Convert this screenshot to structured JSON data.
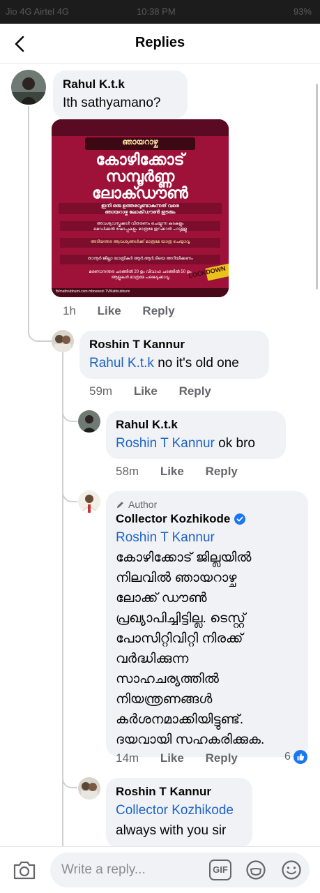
{
  "status": {
    "left": "Jio 4G Airtel 4G",
    "time": "10:38 PM",
    "right": "93%"
  },
  "header": {
    "title": "Replies"
  },
  "comments": [
    {
      "name": "Rahul K.t.k",
      "text": "Ith sathyamano?",
      "time": "1h",
      "like": "Like",
      "reply": "Reply"
    },
    {
      "name": "Roshin T Kannur",
      "mention": "Rahul K.t.k",
      "text": " no it's old one",
      "time": "59m",
      "like": "Like",
      "reply": "Reply"
    },
    {
      "name": "Rahul K.t.k",
      "mention": "Roshin T Kannur",
      "text": " ok bro",
      "time": "58m",
      "like": "Like",
      "reply": "Reply"
    },
    {
      "author_tag": "Author",
      "name": "Collector Kozhikode",
      "mention": "Roshin T Kannur",
      "lines": [
        "കോഴിക്കോട് ജില്ലയിൽ",
        "നിലവിൽ ഞായറാഴ്ച",
        "ലോക്ക് ഡൗൺ",
        "പ്രഖ്യാപിച്ചിട്ടില്ല. ടെസ്റ്റ്",
        "പോസിറ്റിവിറ്റി നിരക്ക്",
        "വർദ്ധിക്കുന്ന",
        "സാഹചര്യത്തിൽ",
        "നിയന്ത്രണങ്ങൾ",
        "കർശനമാക്കിയിട്ടുണ്ട്.",
        "ദയവായി സഹകരിക്കുക."
      ],
      "time": "14m",
      "like": "Like",
      "reply": "Reply",
      "reaction_count": "6"
    },
    {
      "name": "Roshin T Kannur",
      "mention": "Collector Kozhikode",
      "text": "always with you sir"
    }
  ],
  "poster": {
    "top": "ഞായറാഴ്ച",
    "l1": "കോഴിക്കോട്",
    "l2": "സമ്പൂർണ്ണ",
    "l3": "ലോക്ഡൗൺ",
    "sub1": "ഇനി ഒരു ഉത്തരവുണ്ടാകുന്നത് വരെ",
    "sub2": "ഞായറാഴ്ച ലോക്ഡൗൺ തുടരും",
    "b1": "അവശ്യവസ്തുക്കൾ വിതരണം ചെയ്യുന്ന കടകളും",
    "b1b": "മെഡിക്കൽ ഷോപ്പുകളും മാത്രമേ തുറക്കാൻ പാടുള്ളൂ",
    "b2": "അടിയന്തര ആവശ്യങ്ങൾക്ക് മാത്രമേ യാത്ര ചെയ്യാവൂ",
    "b3": "താനൂർ ജില്ലാ യാത്രികർ ആർ.ആർ.ടിയെ അറിയിക്കണം",
    "b4": "മരണാനന്തര ചടങ്ങിൽ 20 ഉം വിവാഹ ചടങ്ങിൽ 50 ഉം",
    "b4b": "ആളുകൾ മാത്രമേ പങ്കെടുക്കാവൂ",
    "footer": "fb/mathrubhumi.com   mbnewsin   TVMathrubhumi",
    "tape": "LOCKDOWN"
  },
  "composer": {
    "placeholder": "Write a reply...",
    "gif": "GIF"
  }
}
